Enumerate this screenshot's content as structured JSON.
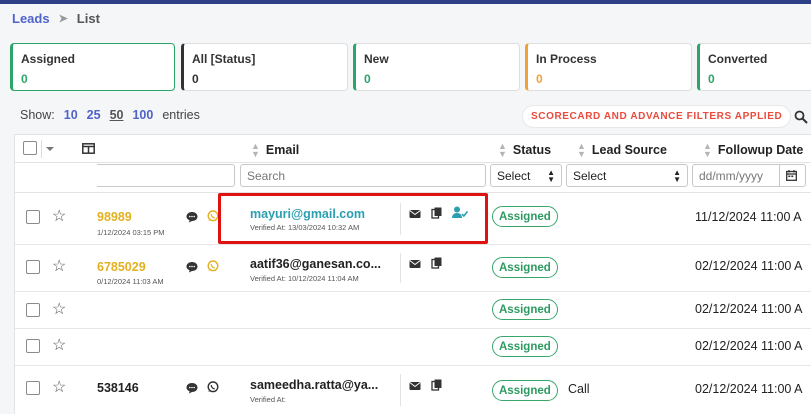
{
  "breadcrumb": {
    "leads": "Leads",
    "separator": "➤",
    "current": "List"
  },
  "cards": [
    {
      "title": "Assigned",
      "count": "0",
      "color": "#2ca56a"
    },
    {
      "title": "All [Status]",
      "count": "0",
      "color": "#333333"
    },
    {
      "title": "New",
      "count": "0",
      "color": "#2ca56a"
    },
    {
      "title": "In Process",
      "count": "0",
      "color": "#f0a23a"
    },
    {
      "title": "Converted",
      "count": "0",
      "color": "#2ca56a"
    }
  ],
  "show_entries": {
    "label": "Show:",
    "options": [
      "10",
      "25",
      "50",
      "100"
    ],
    "selected": "50",
    "suffix": "entries"
  },
  "filters_applied": "SCORECARD AND ADVANCE FILTERS APPLIED",
  "table": {
    "headers": {
      "email": "Email",
      "status": "Status",
      "lead_source": "Lead Source",
      "followup_date": "Followup Date"
    },
    "filters": {
      "search_placeholder": "Search",
      "status_select": "Select",
      "source_select": "Select",
      "date_placeholder": "dd/mm/yyyy"
    },
    "rows": [
      {
        "phone": "98989",
        "phone_color": "#e3b020",
        "phone_date": "1/12/2024 03:15 PM",
        "email": "mayuri@gmail.com",
        "verified": "Verified At: 13/03/2024 10:32 AM",
        "status": "Assigned",
        "source": "",
        "followup": "11/12/2024 11:00 A"
      },
      {
        "phone": "6785029",
        "phone_color": "#e3b020",
        "phone_date": "0/12/2024 11:03 AM",
        "email": "aatif36@ganesan.co...",
        "verified": "Verified At: 10/12/2024 11:04 AM",
        "status": "Assigned",
        "source": "",
        "followup": "02/12/2024 11:00 A"
      },
      {
        "phone": "",
        "phone_date": "",
        "email": "",
        "verified": "",
        "status": "Assigned",
        "source": "",
        "followup": "02/12/2024 11:00 A"
      },
      {
        "phone": "",
        "phone_date": "",
        "email": "",
        "verified": "",
        "status": "Assigned",
        "source": "",
        "followup": "02/12/2024 11:00 A"
      },
      {
        "phone": "538146",
        "phone_color": "#222222",
        "phone_date": "",
        "email": "sameedha.ratta@ya...",
        "verified": "Verified At:",
        "status": "Assigned",
        "source": "Call",
        "followup": "02/12/2024 11:00 A"
      }
    ]
  }
}
